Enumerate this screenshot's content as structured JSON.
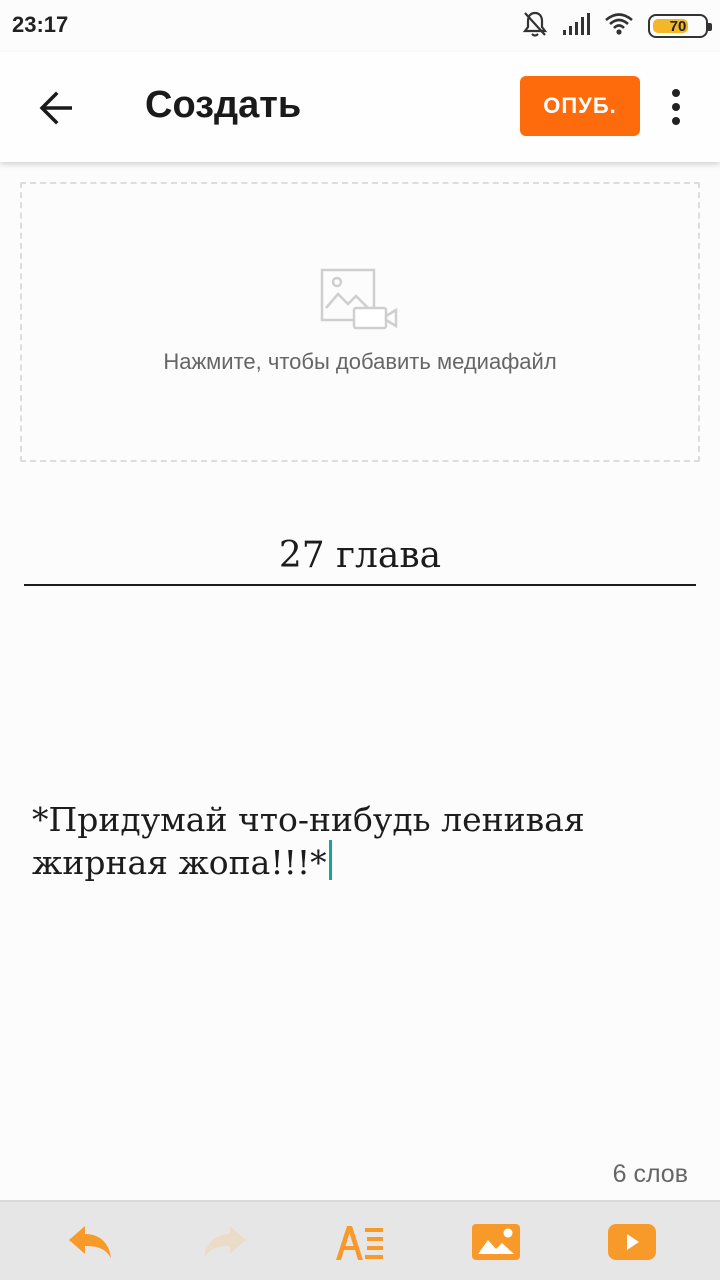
{
  "status_bar": {
    "time": "23:17",
    "battery_level": "70",
    "battery_fill_fraction": 0.7,
    "icons": [
      "bell-off-icon",
      "signal-icon",
      "wifi-icon",
      "battery-icon"
    ]
  },
  "app_bar": {
    "back_icon": "arrow-left-icon",
    "title": "Создать",
    "publish_label": "ОПУБ.",
    "more_icon": "more-vertical-icon"
  },
  "media": {
    "icon": "image-video-icon",
    "prompt": "Нажмите, чтобы добавить медиафайл"
  },
  "editor": {
    "chapter_title": "27 глава",
    "body_text": "*Придумай что-нибудь ленивая жирная жопа!!!*",
    "word_count": "6 слов"
  },
  "toolbar": {
    "items": [
      "undo-icon",
      "redo-icon",
      "text-format-icon",
      "insert-image-icon",
      "insert-video-icon"
    ]
  },
  "colors": {
    "accent": "#fd6b0d",
    "toolbar_icon": "#f79a2a",
    "toolbar_icon_disabled": "#ebdcc8",
    "cursor": "#16a59a",
    "battery": "#f4b728"
  }
}
